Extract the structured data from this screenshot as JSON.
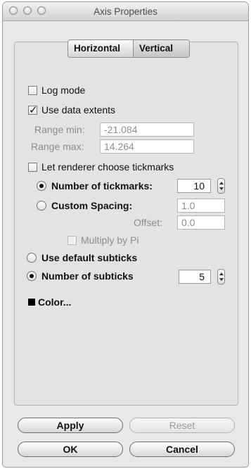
{
  "window": {
    "title": "Axis Properties"
  },
  "tabs": [
    {
      "label": "Horizontal",
      "selected": true
    },
    {
      "label": "Vertical",
      "selected": false
    }
  ],
  "log_mode": {
    "label": "Log mode",
    "checked": false
  },
  "use_data_extents": {
    "label": "Use data extents",
    "checked": true
  },
  "range_min": {
    "label": "Range min:",
    "value": "-21.084"
  },
  "range_max": {
    "label": "Range max:",
    "value": "14.264"
  },
  "let_renderer": {
    "label": "Let renderer choose tickmarks",
    "checked": false
  },
  "num_tickmarks": {
    "label": "Number of tickmarks:",
    "value": "10",
    "selected": true
  },
  "custom_spacing": {
    "label": "Custom Spacing:",
    "value": "1.0",
    "selected": false
  },
  "offset": {
    "label": "Offset:",
    "value": "0.0"
  },
  "multiply_pi": {
    "label": "Multiply by Pi",
    "checked": false
  },
  "default_subticks": {
    "label": "Use default subticks",
    "selected": false
  },
  "num_subticks": {
    "label": "Number of subticks",
    "value": "5",
    "selected": true
  },
  "color": {
    "label": "Color...",
    "swatch": "#000000"
  },
  "buttons": {
    "apply": "Apply",
    "reset": "Reset",
    "ok": "OK",
    "cancel": "Cancel"
  }
}
